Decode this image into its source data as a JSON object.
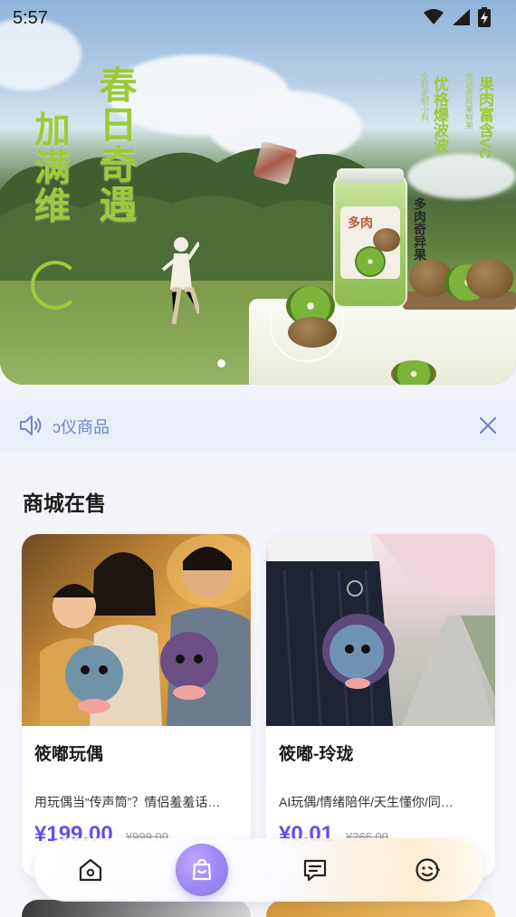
{
  "status_bar": {
    "time": "5:57"
  },
  "banner": {
    "headline_left": "加满维",
    "headline_mid": "春日奇遇",
    "right_big_1": "果肉富含VC",
    "right_small_1": "优选奇异果鲜果",
    "right_big_2": "优格爆波波",
    "right_small_2": "全新定制小料",
    "jar_side_text": "多肉奇异果",
    "jar_label_text": "多肉",
    "active_slide": 1,
    "slide_count": 2
  },
  "notice": {
    "text": "ɔ仪商品"
  },
  "section": {
    "title": "商城在售"
  },
  "products": [
    {
      "name": "筱嘟玩偶",
      "desc": "用玩偶当“传声筒”？情侣羞羞话…",
      "price": "¥199.00",
      "old_price": "¥999.00"
    },
    {
      "name": "筱嘟-玲珑",
      "desc": "AI玩偶/情绪陪伴/天生懂你/同…",
      "price": "¥0.01",
      "old_price": "¥266.00"
    }
  ],
  "tabbar": {
    "items": [
      {
        "icon": "home-icon"
      },
      {
        "icon": "shop-bag-icon",
        "active": true
      },
      {
        "icon": "message-icon"
      },
      {
        "icon": "profile-face-icon"
      }
    ]
  },
  "colors": {
    "accent": "#6a4cf0",
    "notice_bg": "#e9eef9",
    "notice_text": "#6f86c4",
    "banner_green": "#9ccb3a"
  }
}
